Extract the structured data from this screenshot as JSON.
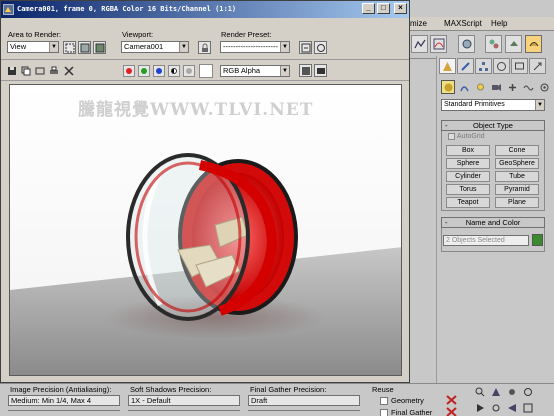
{
  "window": {
    "title": "Camera001, frame 0, RGBA Color 16 Bits/Channel (1:1)",
    "controls": [
      "minimize-icon",
      "maximize-icon",
      "close-icon"
    ]
  },
  "render_controls": {
    "area_label": "Area to Render:",
    "area_value": "View",
    "viewport_label": "Viewport:",
    "viewport_value": "Camera001",
    "preset_label": "Render Preset:",
    "preset_value": "----------------------",
    "channel_value": "RGB Alpha"
  },
  "viewport": {
    "watermark": "騰龍視覺WWW.TLVI.NET"
  },
  "max_menu": {
    "items": [
      "mize",
      "MAXScript",
      "Help"
    ]
  },
  "command_panel": {
    "category": "Standard Primitives",
    "object_type_title": "Object Type",
    "autogrid_label": "AutoGrid",
    "primitives": [
      "Box",
      "Cone",
      "Sphere",
      "GeoSphere",
      "Cylinder",
      "Tube",
      "Torus",
      "Pyramid",
      "Teapot",
      "Plane"
    ],
    "name_color_title": "Name and Color",
    "name_value": "2 Objects Selected",
    "swatch_color": "#3a8a2e"
  },
  "bottom": {
    "image_precision_label": "Image Precision (Antialiasing):",
    "image_precision_value": "Medium: Min 1/4, Max 4",
    "soft_shadows_label": "Soft Shadows Precision:",
    "soft_shadows_value": "1X - Default",
    "final_gather_label": "Final Gather Precision:",
    "final_gather_value": "Draft",
    "reuse_label": "Reuse",
    "geometry_label": "Geometry",
    "final_gather_reuse_label": "Final Gather"
  }
}
